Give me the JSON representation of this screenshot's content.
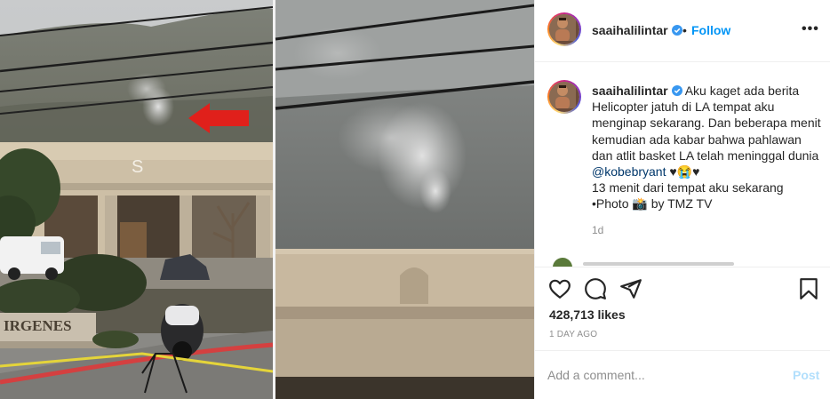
{
  "post": {
    "username": "saaihalilintar",
    "follow_label": "Follow",
    "separator": "•",
    "more_label": "•••",
    "caption_parts": {
      "line1": "Aku kaget ada berita Helicopter jatuh di LA tempat aku menginap sekarang. Dan beberapa menit kemudian ada kabar bahwa pahlawan dan atlit basket LA telah meninggal dunia ",
      "mention": "@kobebryant",
      "emoji_tail": " ♥😭♥",
      "line2": "13 menit dari tempat aku sekarang",
      "line3": "•Photo 📸 by TMZ TV"
    },
    "time_ago": "1d",
    "likes": "428,713 likes",
    "posted": "1 DAY AGO"
  },
  "photo": {
    "sign_letter": "S",
    "sign_text": "IRGENES"
  },
  "comment": {
    "placeholder": "Add a comment...",
    "post_label": "Post"
  },
  "icons": {
    "verified": "verified-badge-icon",
    "like": "heart-icon",
    "comment": "comment-bubble-icon",
    "share": "paper-plane-icon",
    "save": "bookmark-icon"
  },
  "colors": {
    "accent": "#0095f6",
    "post_disabled": "#b2dffc",
    "mention": "#00376b",
    "arrow": "#e0201b"
  }
}
